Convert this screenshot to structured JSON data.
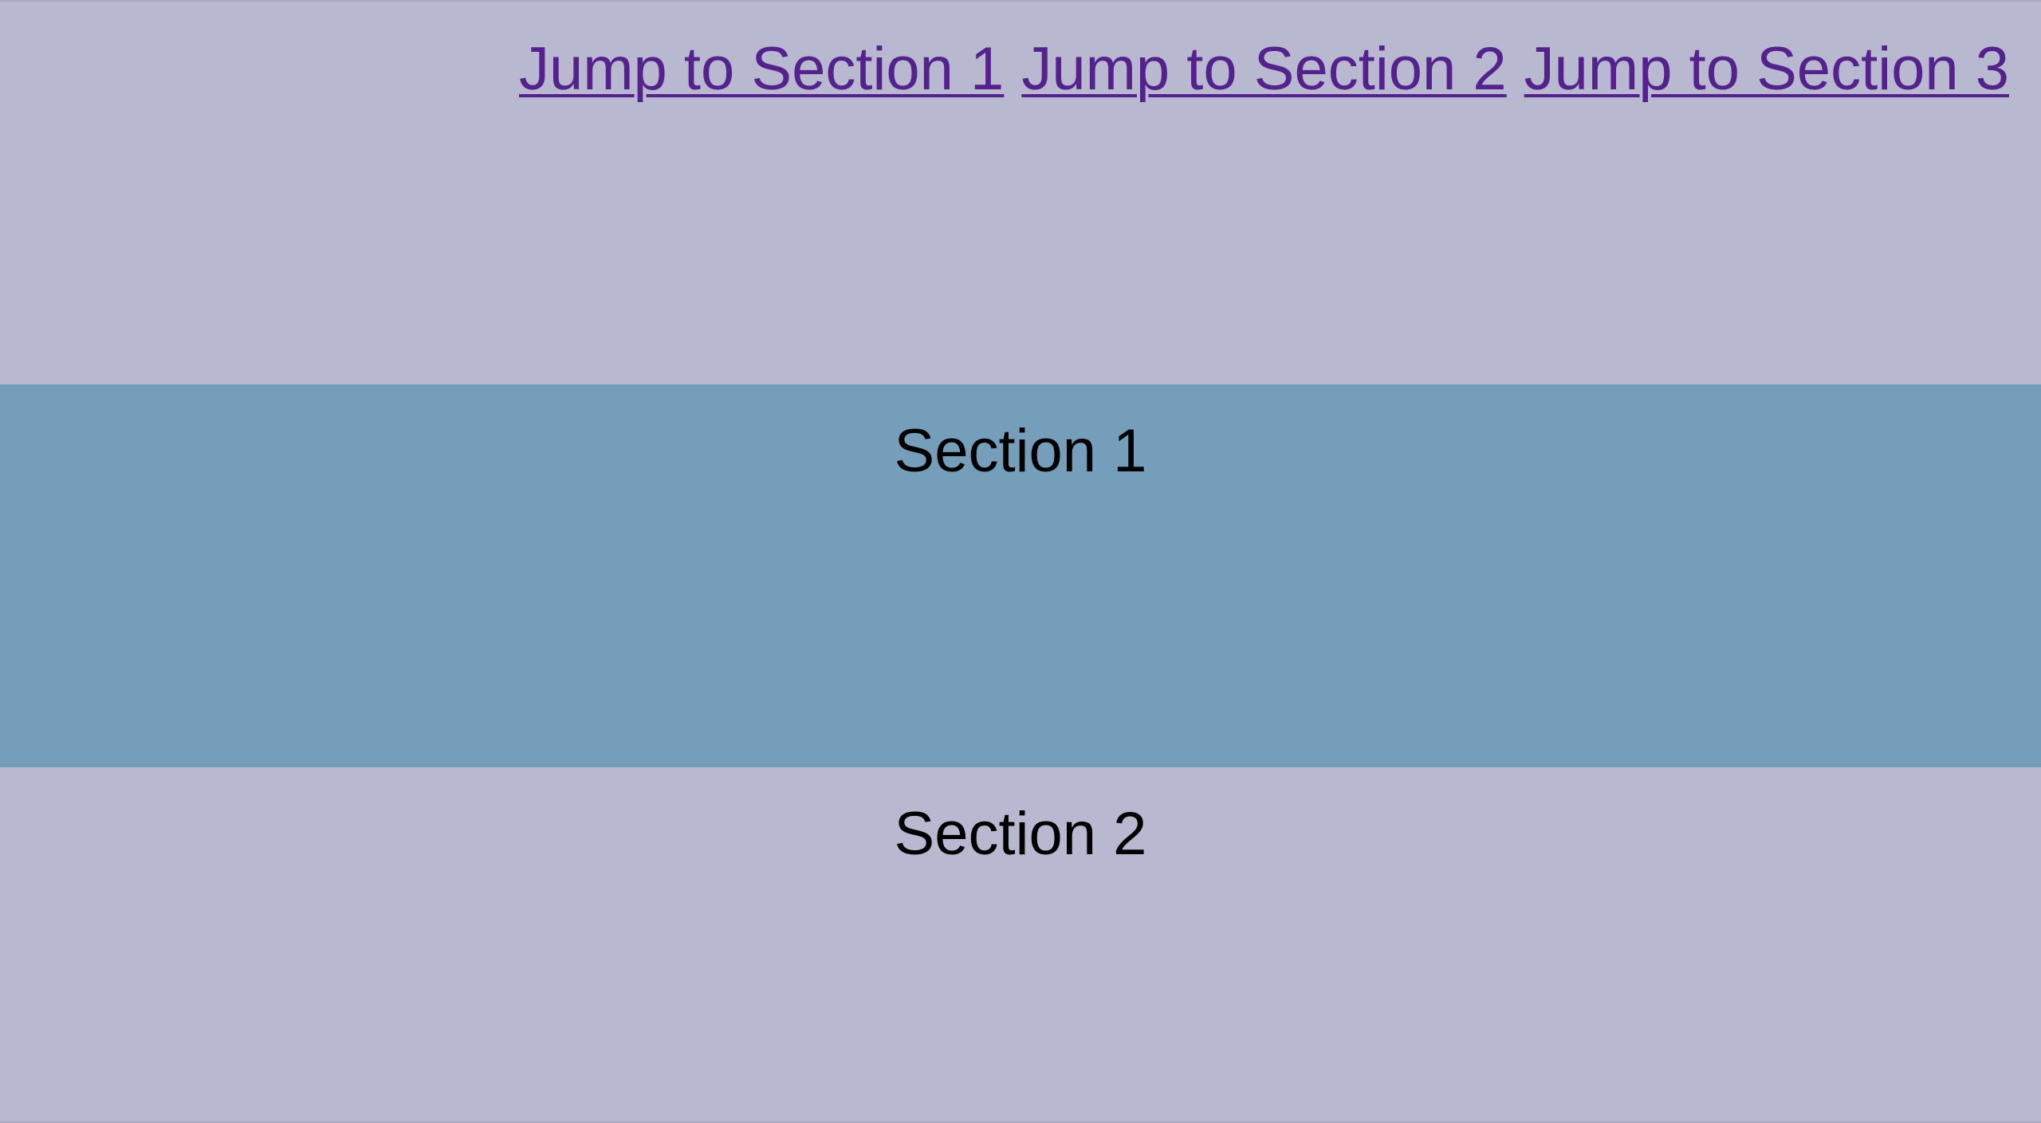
{
  "colors": {
    "page_background": "#b8b8d0",
    "section_1_background": "#759ebb",
    "section_2_background": "#b8b8d0",
    "link_color": "#55218d",
    "text_color": "#000000"
  },
  "navigation": {
    "links": [
      {
        "label": "Jump to Section 1"
      },
      {
        "label": "Jump to Section 2"
      },
      {
        "label": "Jump to Section 3"
      }
    ]
  },
  "sections": [
    {
      "title": "Section 1"
    },
    {
      "title": "Section 2"
    }
  ]
}
